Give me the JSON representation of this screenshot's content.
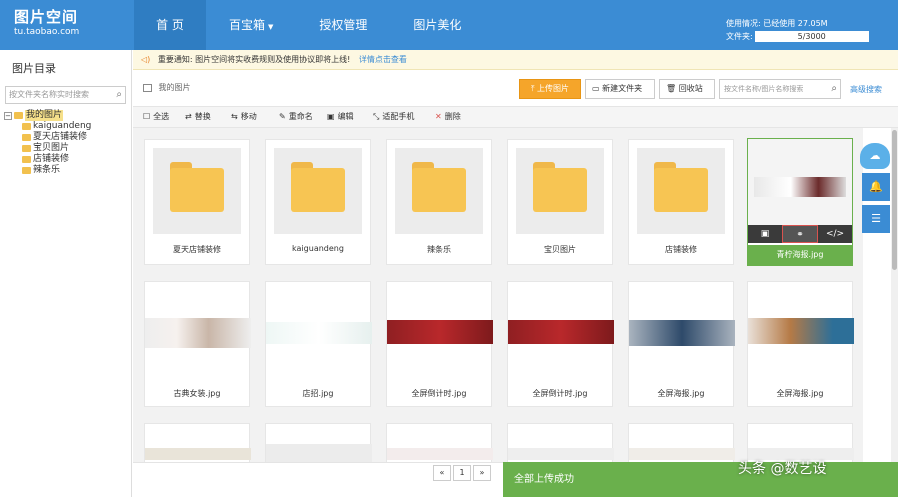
{
  "header": {
    "logo_title": "图片空间",
    "logo_url": "tu.taobao.com",
    "nav": [
      {
        "label": "首 页"
      },
      {
        "label": "百宝箱"
      },
      {
        "label": "授权管理"
      },
      {
        "label": "图片美化"
      }
    ],
    "usage_text": "使用情况: 已经使用 27.05M",
    "file_label": "文件夹:",
    "file_count": "5/3000"
  },
  "sidebar": {
    "title": "图片目录",
    "search_placeholder": "按文件夹名称实时搜索",
    "tree": {
      "root": "我的图片",
      "children": [
        "kaiguandeng",
        "夏天店铺装修",
        "宝贝图片",
        "店铺装修",
        "辣条乐"
      ]
    }
  },
  "notice": {
    "text": "重要通知: 图片空间将实收费规则及使用协议即将上线!",
    "link": "详情点击查看"
  },
  "toolbar": {
    "breadcrumb": "我的图片",
    "upload": "上传图片",
    "new_folder": "新建文件夹",
    "recycle": "回收站",
    "search_placeholder": "按文件名称/图片名称搜索",
    "advanced": "高级搜索"
  },
  "actions": {
    "select_all": "全选",
    "replace": "替换",
    "move": "移动",
    "rename": "重命名",
    "edit": "编辑",
    "mobile": "适配手机",
    "delete": "删除"
  },
  "folders": [
    "夏天店铺装修",
    "kaiguandeng",
    "辣条乐",
    "宝贝图片",
    "店铺装修"
  ],
  "images_row1_selected": "青柠海报.jpg",
  "images": [
    "古典女装.jpg",
    "店招.jpg",
    "全屏倒计时.jpg",
    "全屏倒计时.jpg",
    "全屏海报.jpg",
    "全屏海报.jpg"
  ],
  "pager": {
    "prev": "«",
    "page": "1",
    "next": "»"
  },
  "upload_status": "全部上传成功",
  "watermark": "头条 @数艺设",
  "colors": {
    "primary": "#3b8cd4",
    "upload": "#f5a52a",
    "success": "#6ab04c",
    "folder": "#f7c553"
  }
}
